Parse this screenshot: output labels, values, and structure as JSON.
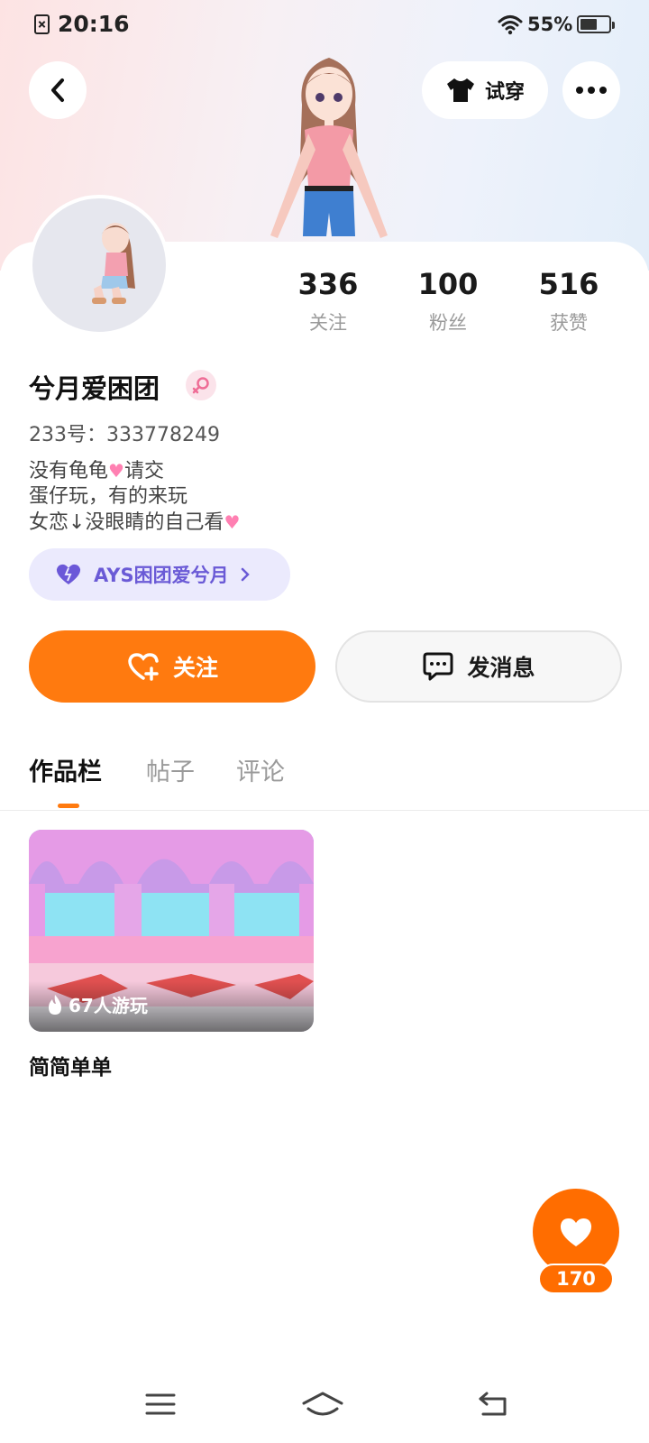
{
  "status_bar": {
    "time": "20:16",
    "battery": "55%"
  },
  "header": {
    "try_on_label": "试穿"
  },
  "stats": [
    {
      "value": "336",
      "label": "关注"
    },
    {
      "value": "100",
      "label": "粉丝"
    },
    {
      "value": "516",
      "label": "获赞"
    }
  ],
  "profile": {
    "username": "兮月爱困团",
    "user_id": "233号：333778249",
    "bio": {
      "line1_a": "没有龟龟",
      "line1_b": "请交",
      "line2": "蛋仔玩，有的来玩",
      "line3": "女恋↓没眼睛的自己看"
    },
    "club_label": "AYS困团爱兮月"
  },
  "actions": {
    "follow_label": "关注",
    "message_label": "发消息"
  },
  "tabs": [
    {
      "label": "作品栏",
      "active": true
    },
    {
      "label": "帖子",
      "active": false
    },
    {
      "label": "评论",
      "active": false
    }
  ],
  "works": [
    {
      "plays": "67人游玩",
      "title": "简简单单"
    }
  ],
  "like_button": {
    "count": "170"
  },
  "colors": {
    "accent": "#ff7a0f",
    "club": "#6a5ad6"
  }
}
